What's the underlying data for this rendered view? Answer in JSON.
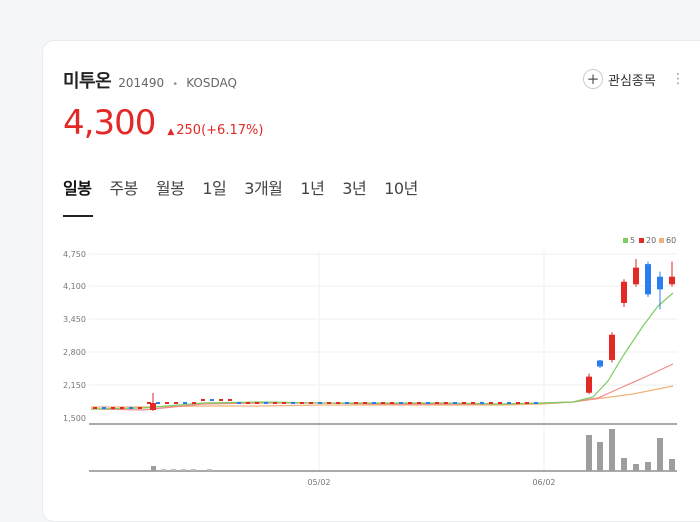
{
  "stock": {
    "name": "미투온",
    "code": "201490",
    "exchange": "KOSDAQ",
    "price": "4,300",
    "change": "250(+6.17%)"
  },
  "actions": {
    "watch_label": "관심종목"
  },
  "tabs": [
    "일봉",
    "주봉",
    "월봉",
    "1일",
    "3개월",
    "1년",
    "3년",
    "10년"
  ],
  "colors": {
    "up": "#e22926",
    "down": "#2a7df0",
    "ma5": "#7ccc62",
    "ma20": "#f2898a",
    "ma60": "#f0b27a"
  },
  "chart_data": {
    "type": "line",
    "legend": [
      "5",
      "20",
      "60"
    ],
    "yticks": [
      "4,750",
      "4,100",
      "3,450",
      "2,800",
      "2,150",
      "1,500"
    ],
    "xticks": [
      "05/02",
      "06/02"
    ],
    "ylim": [
      1500,
      4750
    ],
    "recent_candles": [
      {
        "open": 2000,
        "close": 2320,
        "high": 2380,
        "low": 1970,
        "dir": "up"
      },
      {
        "open": 2640,
        "close": 2520,
        "high": 2650,
        "low": 2490,
        "dir": "down"
      },
      {
        "open": 2650,
        "close": 3150,
        "high": 3200,
        "low": 2600,
        "dir": "up"
      },
      {
        "open": 3780,
        "close": 4200,
        "high": 4250,
        "low": 3700,
        "dir": "up"
      },
      {
        "open": 4150,
        "close": 4480,
        "high": 4650,
        "low": 4100,
        "dir": "up"
      },
      {
        "open": 4550,
        "close": 3950,
        "high": 4600,
        "low": 3900,
        "dir": "down"
      },
      {
        "open": 4300,
        "close": 4050,
        "high": 4400,
        "low": 3650,
        "dir": "down"
      },
      {
        "open": 4150,
        "close": 4300,
        "high": 4600,
        "low": 4100,
        "dir": "up"
      }
    ]
  }
}
